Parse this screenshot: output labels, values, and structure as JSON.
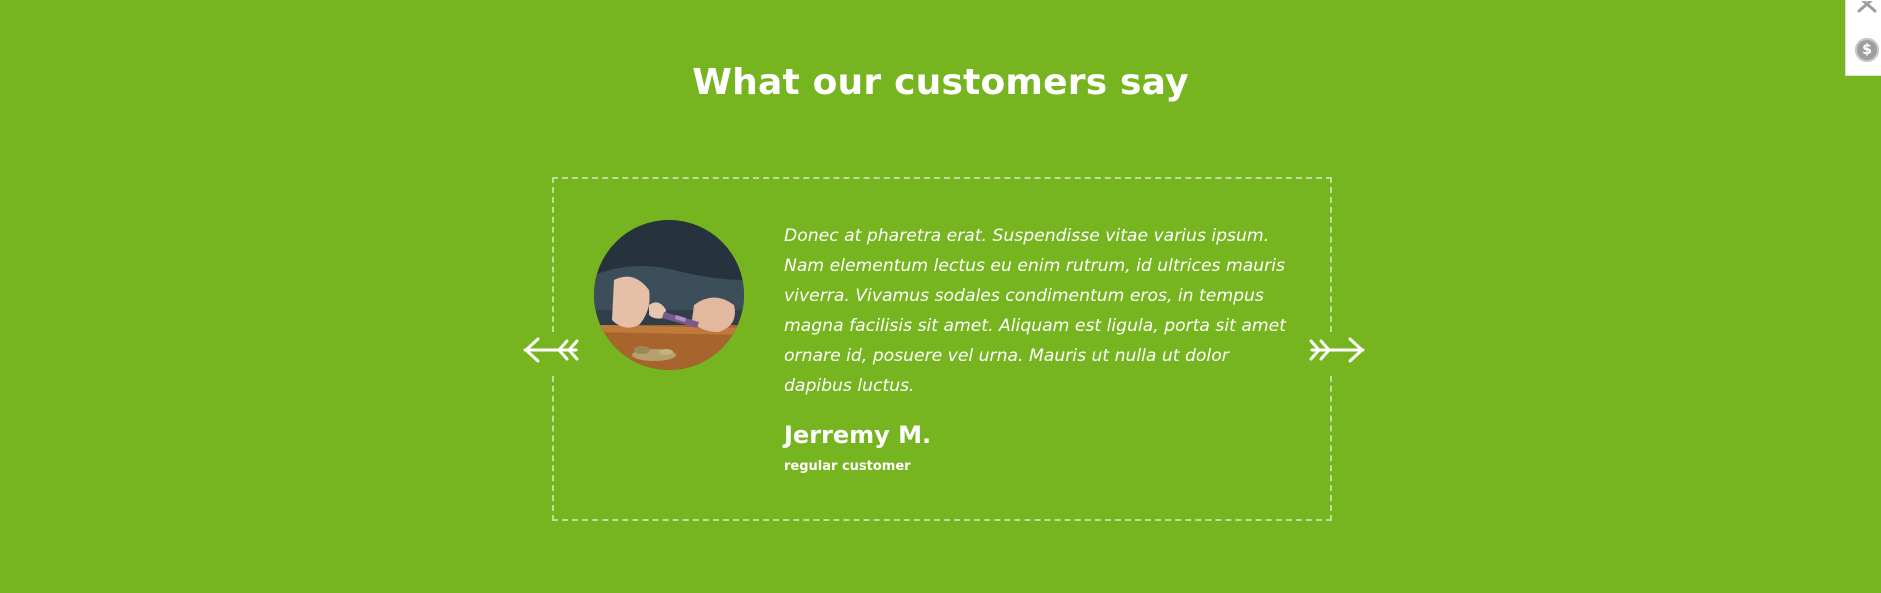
{
  "section": {
    "title": "What our customers say"
  },
  "testimonial": {
    "quote": "Donec at pharetra erat. Suspendisse vitae varius ipsum. Nam elementum lectus eu enim rutrum, id ultrices mauris viverra. Vivamus sodales condimentum eros, in tempus magna facilisis sit amet. Aliquam est ligula, porta sit amet ornare id, posuere vel urna. Mauris ut nulla ut dolor dapibus luctus.",
    "author_name": "Jerremy M.",
    "author_role": "regular customer"
  },
  "navigation": {
    "prev_icon": "arrow-left-icon",
    "next_icon": "arrow-right-icon"
  },
  "side_widget": {
    "close_icon": "close-icon",
    "coin_glyph": "$"
  },
  "colors": {
    "background": "#76b51f",
    "text": "#ffffff"
  }
}
